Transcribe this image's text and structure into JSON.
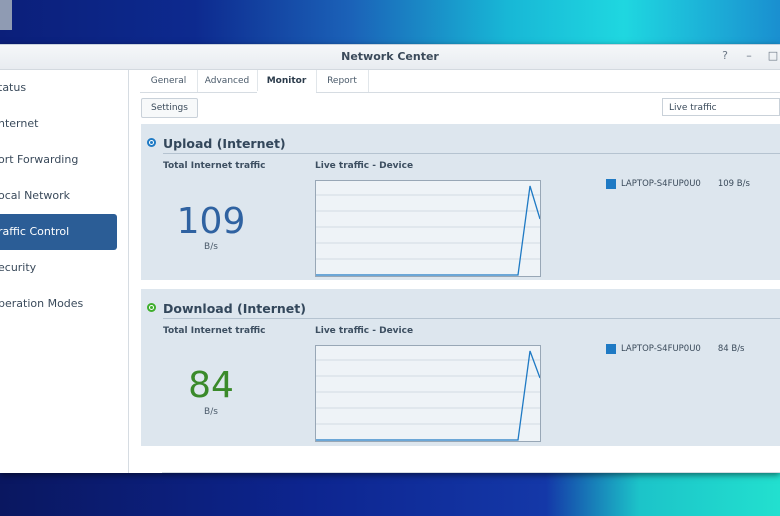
{
  "window": {
    "title": "Network Center",
    "controls": [
      "?",
      "–",
      "□"
    ]
  },
  "sidebar": {
    "items": [
      {
        "label": "Status",
        "shown": "tatus"
      },
      {
        "label": "Internet",
        "shown": "nternet"
      },
      {
        "label": "Port Forwarding",
        "shown": "ort Forwarding"
      },
      {
        "label": "Local Network",
        "shown": "ocal Network"
      },
      {
        "label": "Traffic Control",
        "shown": "raffic Control",
        "active": true
      },
      {
        "label": "Security",
        "shown": "ecurity"
      },
      {
        "label": "Operation Modes",
        "shown": "peration Modes"
      }
    ]
  },
  "tabs": [
    {
      "label": "General"
    },
    {
      "label": "Advanced"
    },
    {
      "label": "Monitor",
      "active": true
    },
    {
      "label": "Report"
    }
  ],
  "toolbar": {
    "settings_label": "Settings",
    "select_value": "Live traffic"
  },
  "upload": {
    "title": "Upload (Internet)",
    "total_label": "Total Internet traffic",
    "live_label": "Live traffic - Device",
    "value": "109",
    "unit": "B/s",
    "legend_device": "LAPTOP-S4FUP0U0",
    "legend_value": "109 B/s",
    "icon_color": "#1f7ac4",
    "value_color": "#2f62a1"
  },
  "download": {
    "title": "Download (Internet)",
    "total_label": "Total Internet traffic",
    "live_label": "Live traffic - Device",
    "value": "84",
    "unit": "B/s",
    "legend_device": "LAPTOP-S4FUP0U0",
    "legend_value": "84 B/s",
    "icon_color": "#3fae2e",
    "value_color": "#3a8a2a"
  },
  "colors": {
    "accent": "#2b5d96",
    "series": "#1f7ac4"
  }
}
